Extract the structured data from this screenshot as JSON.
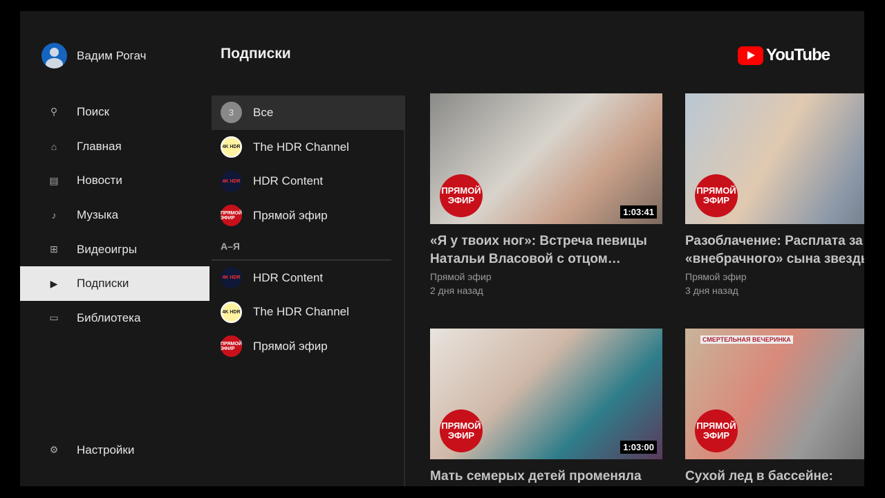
{
  "user": {
    "name": "Вадим Рогач"
  },
  "nav": [
    {
      "label": "Поиск",
      "icon": "search-icon",
      "glyph": "⚲"
    },
    {
      "label": "Главная",
      "icon": "home-icon",
      "glyph": "⌂"
    },
    {
      "label": "Новости",
      "icon": "news-icon",
      "glyph": "▤"
    },
    {
      "label": "Музыка",
      "icon": "music-icon",
      "glyph": "♪"
    },
    {
      "label": "Видеоигры",
      "icon": "gamepad-icon",
      "glyph": "⊞"
    },
    {
      "label": "Подписки",
      "icon": "subscriptions-icon",
      "glyph": "▶"
    },
    {
      "label": "Библиотека",
      "icon": "folder-icon",
      "glyph": "▭"
    }
  ],
  "settings": {
    "label": "Настройки",
    "glyph": "⚙"
  },
  "page_title": "Подписки",
  "logo": "YouTube",
  "channels_top": [
    {
      "label": "Все",
      "avatar": "3"
    },
    {
      "label": "The HDR Channel",
      "avatar": "4K HDR"
    },
    {
      "label": "HDR Content",
      "avatar": "4K HDR"
    },
    {
      "label": "Прямой эфир",
      "avatar": "ПРЯМОЙ ЭФИР"
    }
  ],
  "az_header": "А–Я",
  "channels_az": [
    {
      "label": "HDR Content",
      "avatar": "4K HDR"
    },
    {
      "label": "The HDR Channel",
      "avatar": "4K HDR"
    },
    {
      "label": "Прямой эфир",
      "avatar": "ПРЯМОЙ ЭФИР"
    }
  ],
  "badge_text": "ПРЯМОЙ ЭФИР",
  "videos": [
    {
      "title1": "«Я у твоих ног»: Встреча певицы",
      "title2": "Натальи Власовой с отцом…",
      "channel": "Прямой эфир",
      "age": "2 дня назад",
      "duration": "1:03:41"
    },
    {
      "title1": "Разоблачение: Расплата за",
      "title2": "«внебрачного» сына звезды",
      "channel": "Прямой эфир",
      "age": "3 дня назад",
      "duration": ""
    },
    {
      "title1": "Мать семерых детей променяла",
      "title2": "",
      "channel": "",
      "age": "",
      "duration": "1:03:00"
    },
    {
      "title1": "Сухой лед в бассейне:",
      "title2": "",
      "channel": "",
      "age": "",
      "duration": "",
      "overlay": "СМЕРТЕЛЬНАЯ ВЕЧЕРИНКА"
    }
  ]
}
